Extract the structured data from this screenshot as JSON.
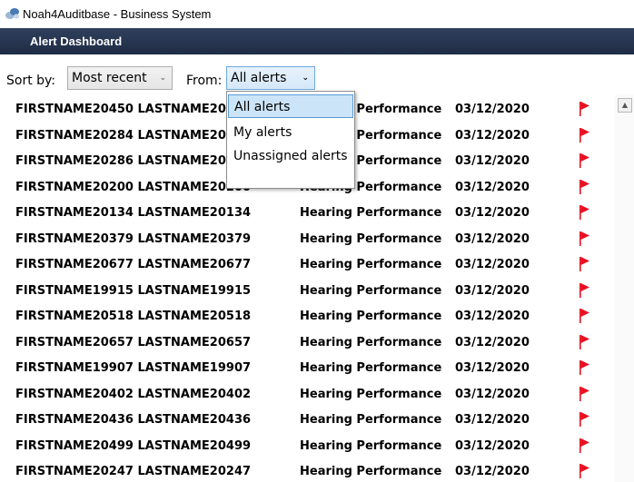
{
  "window": {
    "title": "Noah4Auditbase - Business System",
    "app_icon": "noah-app-icon"
  },
  "header": {
    "title": "Alert Dashboard",
    "bg_color": "#23314d"
  },
  "filters": {
    "sort_label": "Sort by:",
    "sort_value": "Most recent",
    "from_label": "From:",
    "from_value": "All alerts"
  },
  "from_dropdown": {
    "options": [
      "All alerts",
      "My alerts",
      "Unassigned alerts"
    ],
    "selected_index": 0
  },
  "alerts": [
    {
      "name": "FIRSTNAME20450 LASTNAME20450",
      "type": "Hearing Performance",
      "date": "03/12/2020"
    },
    {
      "name": "FIRSTNAME20284 LASTNAME20284",
      "type": "Hearing Performance",
      "date": "03/12/2020"
    },
    {
      "name": "FIRSTNAME20286 LASTNAME20286",
      "type": "Hearing Performance",
      "date": "03/12/2020"
    },
    {
      "name": "FIRSTNAME20200 LASTNAME20200",
      "type": "Hearing Performance",
      "date": "03/12/2020"
    },
    {
      "name": "FIRSTNAME20134 LASTNAME20134",
      "type": "Hearing Performance",
      "date": "03/12/2020"
    },
    {
      "name": "FIRSTNAME20379 LASTNAME20379",
      "type": "Hearing Performance",
      "date": "03/12/2020"
    },
    {
      "name": "FIRSTNAME20677 LASTNAME20677",
      "type": "Hearing Performance",
      "date": "03/12/2020"
    },
    {
      "name": "FIRSTNAME19915 LASTNAME19915",
      "type": "Hearing Performance",
      "date": "03/12/2020"
    },
    {
      "name": "FIRSTNAME20518 LASTNAME20518",
      "type": "Hearing Performance",
      "date": "03/12/2020"
    },
    {
      "name": "FIRSTNAME20657 LASTNAME20657",
      "type": "Hearing Performance",
      "date": "03/12/2020"
    },
    {
      "name": "FIRSTNAME19907 LASTNAME19907",
      "type": "Hearing Performance",
      "date": "03/12/2020"
    },
    {
      "name": "FIRSTNAME20402 LASTNAME20402",
      "type": "Hearing Performance",
      "date": "03/12/2020"
    },
    {
      "name": "FIRSTNAME20436 LASTNAME20436",
      "type": "Hearing Performance",
      "date": "03/12/2020"
    },
    {
      "name": "FIRSTNAME20499 LASTNAME20499",
      "type": "Hearing Performance",
      "date": "03/12/2020"
    },
    {
      "name": "FIRSTNAME20247 LASTNAME20247",
      "type": "Hearing Performance",
      "date": "03/12/2020"
    }
  ],
  "flag_color": "#e81123",
  "flag_icon": "red-flag-icon",
  "scroll_icon": "scroll-up-arrow-icon"
}
